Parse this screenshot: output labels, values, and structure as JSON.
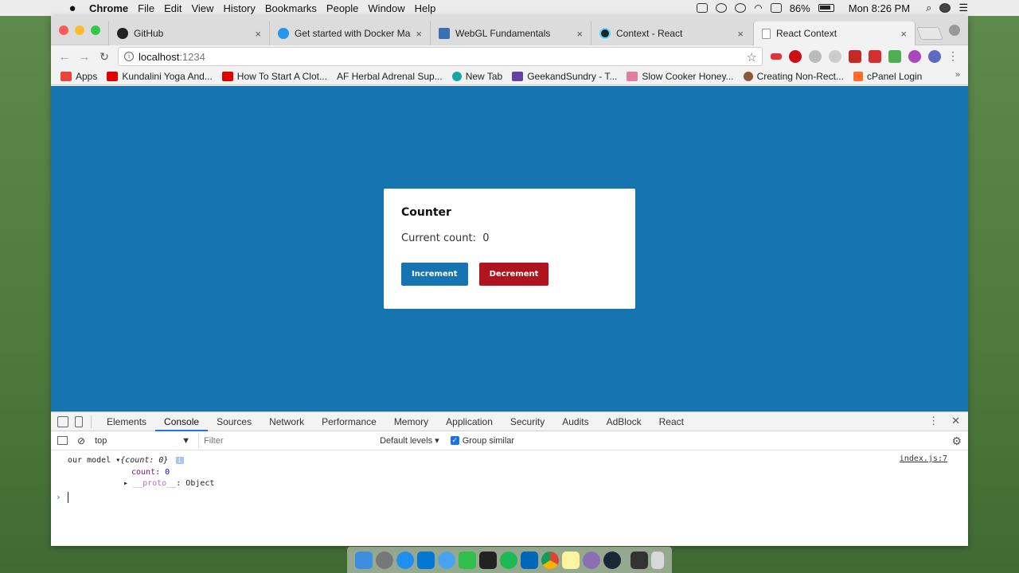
{
  "menubar": {
    "apple": "",
    "items": [
      "Chrome",
      "File",
      "Edit",
      "View",
      "History",
      "Bookmarks",
      "People",
      "Window",
      "Help"
    ],
    "battery": "86%",
    "clock": "Mon 8:26 PM"
  },
  "tabs": [
    {
      "title": "GitHub",
      "close": "×",
      "color": "#222222"
    },
    {
      "title": "Get started with Docker Machi",
      "close": "×",
      "color": "#2496ed"
    },
    {
      "title": "WebGL Fundamentals",
      "close": "×",
      "color": "#3a6fb0"
    },
    {
      "title": "Context - React",
      "close": "×",
      "color": "#20232a"
    },
    {
      "title": "React Context",
      "close": "×",
      "color": "#bbbbbb"
    }
  ],
  "address": {
    "host": "localhost",
    "port": ":1234"
  },
  "bookmarks": [
    {
      "label": "Apps",
      "color": "#e8453c"
    },
    {
      "label": "Kundalini Yoga And...",
      "color": "#e00000"
    },
    {
      "label": "How To Start A Clot...",
      "color": "#e00000"
    },
    {
      "label": "AF Herbal Adrenal Sup...",
      "color": "#4caf8a"
    },
    {
      "label": "New Tab",
      "color": "#15a7a3"
    },
    {
      "label": "GeekandSundry - T...",
      "color": "#6441a5"
    },
    {
      "label": "Slow Cooker Honey...",
      "color": "#e27ca0"
    },
    {
      "label": "Creating Non-Rect...",
      "color": "#8b5a3c"
    },
    {
      "label": "cPanel Login",
      "color": "#ff6c2c"
    }
  ],
  "counter": {
    "title": "Counter",
    "label": "Current count:",
    "value": "0",
    "increment": "Increment",
    "decrement": "Decrement"
  },
  "devtools": {
    "tabs": [
      "Elements",
      "Console",
      "Sources",
      "Network",
      "Performance",
      "Memory",
      "Application",
      "Security",
      "Audits",
      "AdBlock",
      "React"
    ],
    "active_tab": "Console",
    "context": "top",
    "filter_placeholder": "Filter",
    "levels": "Default levels",
    "group_similar": "Group similar",
    "log": {
      "prefix": "our model",
      "summary": "{count: 0}",
      "count_key": "count",
      "count_val": "0",
      "proto_key": "__proto__",
      "proto_val": "Object",
      "source": "index.js:7"
    }
  },
  "colors": {
    "page_bg": "#1674b0",
    "increment": "#1674b0",
    "decrement": "#b0141e"
  }
}
